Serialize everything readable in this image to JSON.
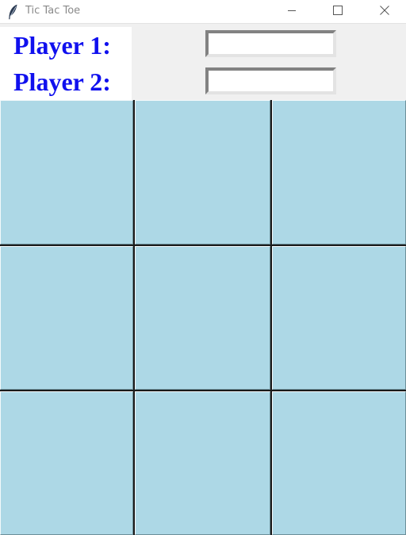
{
  "window": {
    "title": "Tic Tac Toe",
    "icon": "feather-icon",
    "controls": [
      "minimize-icon",
      "maximize-icon",
      "close-icon"
    ]
  },
  "players": {
    "player1": {
      "label": "Player 1:",
      "value": "",
      "placeholder": ""
    },
    "player2": {
      "label": "Player 2:",
      "value": "",
      "placeholder": ""
    },
    "label_color": "#1010ee"
  },
  "board": {
    "cell_color": "#add8e6",
    "rows": [
      [
        "",
        "",
        ""
      ],
      [
        "",
        "",
        ""
      ],
      [
        "",
        "",
        ""
      ]
    ]
  }
}
